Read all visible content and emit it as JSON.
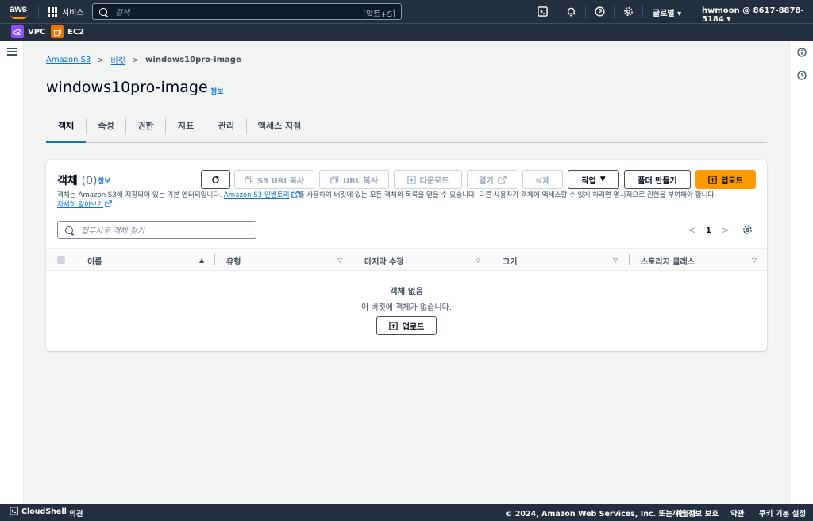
{
  "topnav": {
    "logo_text": "aws",
    "services_label": "서비스",
    "search_placeholder": "검색",
    "search_shortcut": "[알트+S]",
    "region_label": "글로벌 ▾",
    "account_label": "hwmoon @ 8617-8878-5184 ▾",
    "icons": [
      "cloudshell-icon",
      "bell-icon",
      "help-icon",
      "gear-icon"
    ]
  },
  "favorites": [
    {
      "label": "VPC",
      "color": "#8c4fff"
    },
    {
      "label": "EC2",
      "color": "#ed7100"
    }
  ],
  "breadcrumb": {
    "items": [
      "Amazon S3",
      "버킷"
    ],
    "current": "windows10pro-image"
  },
  "page": {
    "title": "windows10pro-image",
    "info_label": "정보"
  },
  "tabs": [
    "객체",
    "속성",
    "권한",
    "지표",
    "관리",
    "액세스 지점"
  ],
  "objects_panel": {
    "title": "객체",
    "count": "(0)",
    "info_label": "정보",
    "buttons": {
      "copy_s3_uri": "S3 URI 복사",
      "copy_url": "URL 복사",
      "download": "다운로드",
      "open": "열기",
      "delete": "삭제",
      "actions": "작업",
      "create_folder": "폴더 만들기",
      "upload": "업로드"
    },
    "description_part1": "객체는 Amazon S3에 저장되어 있는 기본 엔터티입니다.",
    "description_link": "Amazon S3 인벤토리",
    "description_part2": "를 사용하여 버킷에 있는 모든 객체의 목록을 얻을 수 있습니다. 다른 사용자가 객체에 액세스할 수 있게 하려면 명시적으로 권한을 부여해야 합니다.",
    "learn_more": "자세히 알아보기",
    "filter_placeholder": "접두사로 객체 찾기",
    "page_number": "1",
    "columns": [
      "이름",
      "유형",
      "마지막 수정",
      "크기",
      "스토리지 클래스"
    ],
    "empty_title": "객체 없음",
    "empty_subtitle": "이 버킷에 객체가 없습니다.",
    "empty_upload": "업로드"
  },
  "footer": {
    "cloudshell": "CloudShell",
    "feedback": "의견",
    "copyright": "© 2024, Amazon Web Services, Inc. 또는 계열사.",
    "privacy": "개인 정보 보호",
    "terms": "약관",
    "cookies": "쿠키 기본 설정"
  },
  "colors": {
    "nav_bg": "#232f3e",
    "link": "#0972d3",
    "primary_button": "#ff9900",
    "active_tab": "#0972d3"
  }
}
